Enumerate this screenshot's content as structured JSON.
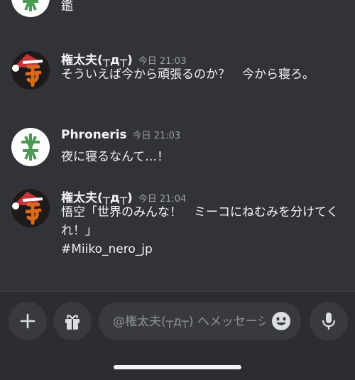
{
  "messages": [
    {
      "text": "やりたいことより納期を優先できるクリエイターの鑑"
    },
    {
      "author": "権太夫(┬д┬)",
      "timestamp": "今日 21:03",
      "text": "そういえば今から頑張るのか？　今から寝ろ。",
      "avatar": "santa-hat-avatar"
    },
    {
      "author": "Phroneris",
      "timestamp": "今日 21:03",
      "text": "夜に寝るなんて…！",
      "avatar": "bamboo-avatar"
    },
    {
      "author": "権太夫(┬д┬)",
      "timestamp": "今日 21:04",
      "text": "悟空「世界のみんな！　ミーコにねむみを分けてくれ！」\n#Miiko_nero_jp",
      "avatar": "santa-hat-avatar"
    }
  ],
  "composer": {
    "placeholder": "@権太夫(┬д┬) へメッセージを送信",
    "add_icon": "plus-icon",
    "gift_icon": "gift-icon",
    "emoji_icon": "emoji-icon",
    "mic_icon": "microphone-icon"
  },
  "colors": {
    "background": "#313338",
    "composer_background": "#2b2d31",
    "button_background": "#383a40",
    "text": "#f2f3f5",
    "muted": "#9ba0a8"
  }
}
